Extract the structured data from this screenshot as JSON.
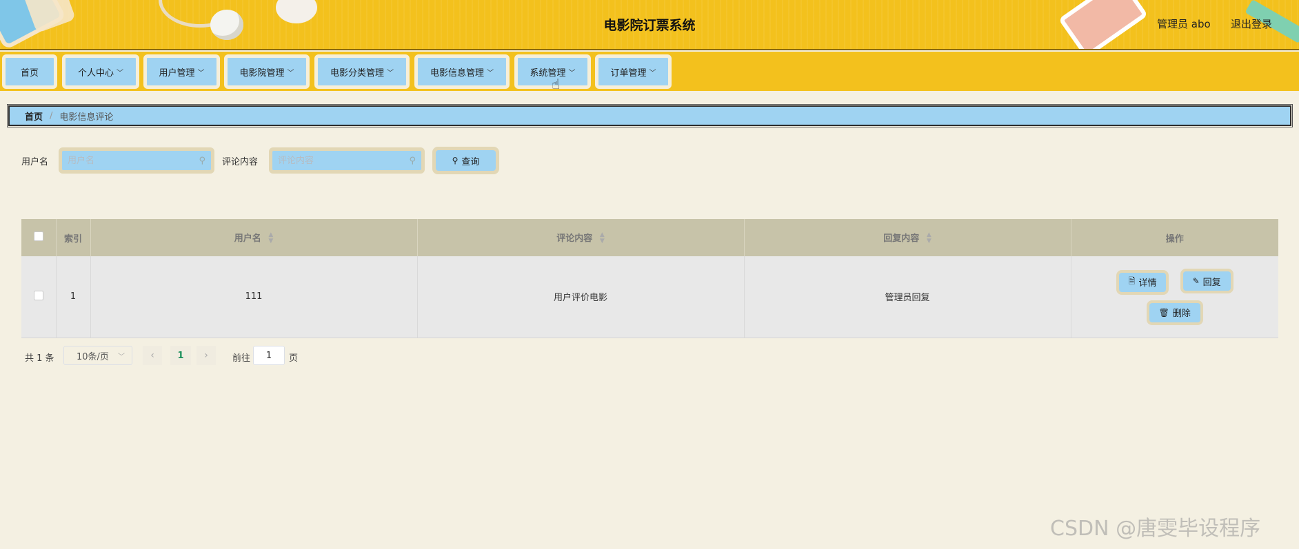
{
  "header": {
    "title": "电影院订票系统",
    "admin_label": "管理员 abo",
    "logout_label": "退出登录"
  },
  "nav": {
    "items": [
      {
        "label": "首页",
        "has_dropdown": false
      },
      {
        "label": "个人中心",
        "has_dropdown": true
      },
      {
        "label": "用户管理",
        "has_dropdown": true
      },
      {
        "label": "电影院管理",
        "has_dropdown": true
      },
      {
        "label": "电影分类管理",
        "has_dropdown": true
      },
      {
        "label": "电影信息管理",
        "has_dropdown": true
      },
      {
        "label": "系统管理",
        "has_dropdown": true
      },
      {
        "label": "订单管理",
        "has_dropdown": true
      }
    ],
    "chevron": "chevron-down-icon"
  },
  "breadcrumb": {
    "home": "首页",
    "separator": "/",
    "current": "电影信息评论"
  },
  "search": {
    "username_label": "用户名",
    "username_placeholder": "用户名",
    "username_value": "",
    "comment_label": "评论内容",
    "comment_placeholder": "评论内容",
    "comment_value": "",
    "query_label": "查询"
  },
  "table": {
    "columns": {
      "index": "索引",
      "username": "用户名",
      "comment": "评论内容",
      "reply": "回复内容",
      "actions": "操作"
    },
    "rows": [
      {
        "index": "1",
        "username": "111",
        "comment": "用户评价电影",
        "reply": "管理员回复"
      }
    ],
    "actions": {
      "detail": "详情",
      "reply": "回复",
      "delete": "删除"
    }
  },
  "pagination": {
    "total": "共 1 条",
    "page_size": "10条/页",
    "current_page": "1",
    "goto_prefix": "前往",
    "goto_value": "1",
    "goto_suffix": "页"
  },
  "watermark": "CSDN @唐雯毕设程序",
  "colors": {
    "header_bg": "#f3c11d",
    "button_bg": "#9fd3f2",
    "button_border": "#e2d7b5",
    "page_bg": "#f4f0e2",
    "table_header_bg": "#c7c3a9"
  }
}
